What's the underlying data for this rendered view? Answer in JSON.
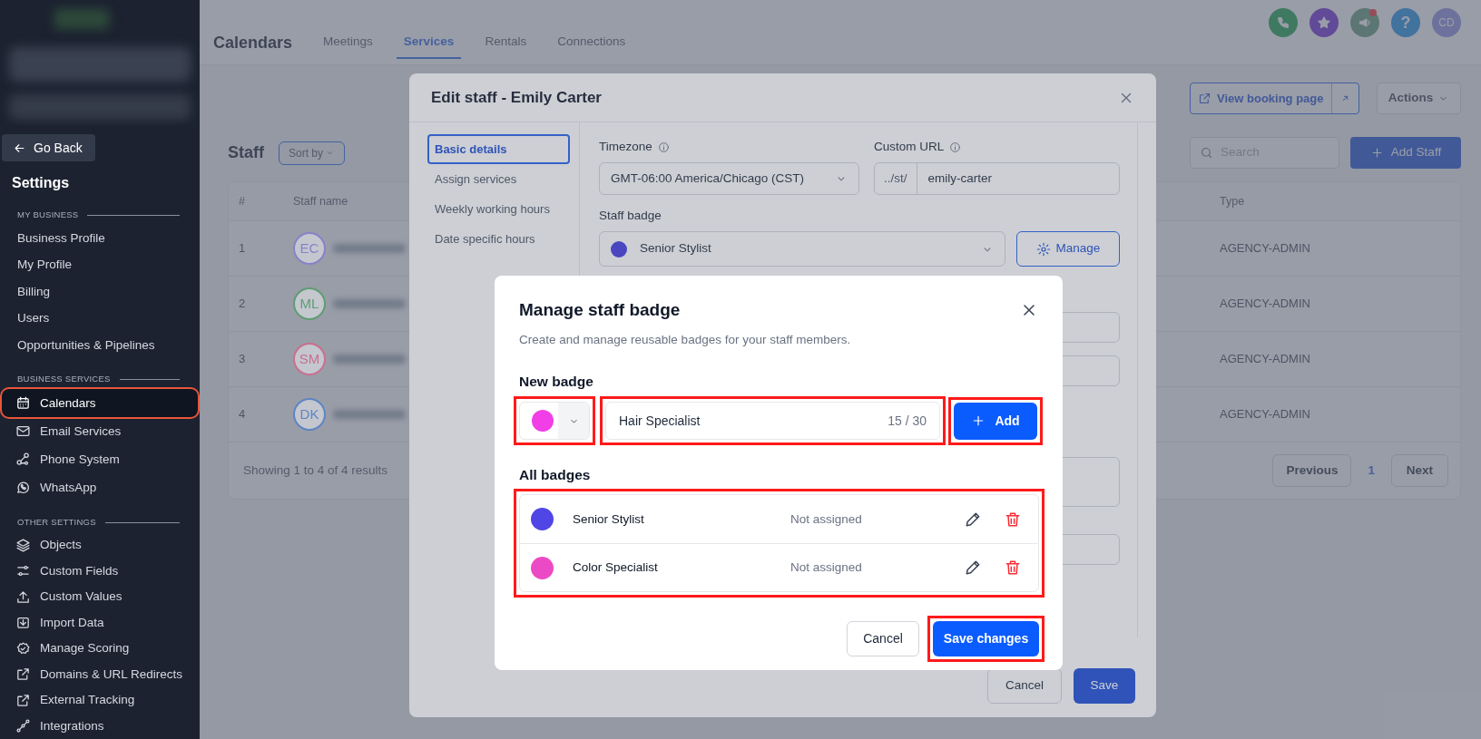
{
  "sidebar": {
    "back_button": "Go Back",
    "title": "Settings",
    "sections": [
      {
        "heading": "MY BUSINESS",
        "items": [
          {
            "label": "Business Profile",
            "selected": false,
            "highlighted": false
          },
          {
            "label": "My Profile",
            "selected": false,
            "highlighted": false
          },
          {
            "label": "Billing",
            "selected": false,
            "highlighted": false
          },
          {
            "label": "Users",
            "selected": false,
            "highlighted": false
          },
          {
            "label": "Opportunities & Pipelines",
            "selected": false,
            "highlighted": false
          }
        ]
      },
      {
        "heading": "BUSINESS SERVICES",
        "items": [
          {
            "label": "Calendars",
            "selected": true,
            "highlighted": true
          },
          {
            "label": "Email Services",
            "selected": false,
            "highlighted": false
          },
          {
            "label": "Phone System",
            "selected": false,
            "highlighted": false
          },
          {
            "label": "WhatsApp",
            "selected": false,
            "highlighted": false
          }
        ]
      },
      {
        "heading": "OTHER SETTINGS",
        "items": [
          {
            "label": "Objects",
            "selected": false,
            "highlighted": false
          },
          {
            "label": "Custom Fields",
            "selected": false,
            "highlighted": false
          },
          {
            "label": "Custom Values",
            "selected": false,
            "highlighted": false
          },
          {
            "label": "Import Data",
            "selected": false,
            "highlighted": false
          },
          {
            "label": "Manage Scoring",
            "selected": false,
            "highlighted": false
          },
          {
            "label": "Domains & URL Redirects",
            "selected": false,
            "highlighted": false
          },
          {
            "label": "External Tracking",
            "selected": false,
            "highlighted": false
          },
          {
            "label": "Integrations",
            "selected": false,
            "highlighted": false
          }
        ]
      }
    ]
  },
  "header": {
    "title": "Calendars",
    "tabs": [
      {
        "label": "Meetings",
        "selected": false
      },
      {
        "label": "Services",
        "selected": true
      },
      {
        "label": "Rentals",
        "selected": false
      },
      {
        "label": "Connections",
        "selected": false
      }
    ],
    "help_glyph": "?",
    "avatar": "CD",
    "notification": true
  },
  "page": {
    "view_booking_button": "View booking page",
    "actions_button": "Actions",
    "heading": "Staff",
    "sort_button": "Sort by",
    "search": {
      "placeholder": "Search"
    },
    "add_button": "Add Staff",
    "table": {
      "columns": [
        "#",
        "Staff name",
        "Type"
      ],
      "rows": [
        {
          "number": "1",
          "initials": "EC",
          "color": "#8a80c9",
          "type": "AGENCY-ADMIN"
        },
        {
          "number": "2",
          "initials": "ML",
          "color": "#5e9d73",
          "type": "AGENCY-ADMIN"
        },
        {
          "number": "3",
          "initials": "SM",
          "color": "#c9708f",
          "type": "AGENCY-ADMIN"
        },
        {
          "number": "4",
          "initials": "DK",
          "color": "#5d85c4",
          "type": "AGENCY-ADMIN"
        }
      ],
      "footer": "Showing 1 to 4 of 4 results",
      "pagination": {
        "previous": "Previous",
        "page": "1",
        "next": "Next"
      }
    }
  },
  "edit_staff": {
    "title": "Edit staff - Emily Carter",
    "nav": [
      {
        "label": "Basic details",
        "selected": true
      },
      {
        "label": "Assign services",
        "selected": false
      },
      {
        "label": "Weekly working hours",
        "selected": false
      },
      {
        "label": "Date specific hours",
        "selected": false
      }
    ],
    "timezone": {
      "label": "Timezone",
      "value": "GMT-06:00 America/Chicago (CST)"
    },
    "custom_url": {
      "label": "Custom URL",
      "prefix": "../st/",
      "value": "emily-carter"
    },
    "staff_badge": {
      "label": "Staff badge",
      "value": "Senior Stylist",
      "color": "#4a46c0"
    },
    "manage_button": "Manage",
    "extra_fields": [
      {
        "kind": "input"
      },
      {
        "kind": "input"
      },
      {
        "kind": "textarea"
      },
      {
        "kind": "input"
      }
    ],
    "buttons": {
      "cancel": "Cancel",
      "save": "Save"
    }
  },
  "badge_dialog": {
    "title": "Manage staff badge",
    "subtitle": "Create and manage reusable badges for your staff members.",
    "new_badge": {
      "heading": "New badge",
      "color": "#f23ee6",
      "color_highlighted": true,
      "name": "Hair Specialist",
      "counter": "15 / 30",
      "name_highlighted": true,
      "add_button": "Add",
      "add_highlighted": true
    },
    "all_badges": {
      "heading": "All badges",
      "highlighted": true,
      "badges": [
        {
          "name": "Senior Stylist",
          "color": "#4f46e5",
          "status": "Not assigned"
        },
        {
          "name": "Color Specialist",
          "color": "#ec4ac4",
          "status": "Not assigned"
        }
      ]
    },
    "buttons": {
      "cancel": "Cancel",
      "save": "Save changes",
      "save_highlighted": true
    }
  }
}
